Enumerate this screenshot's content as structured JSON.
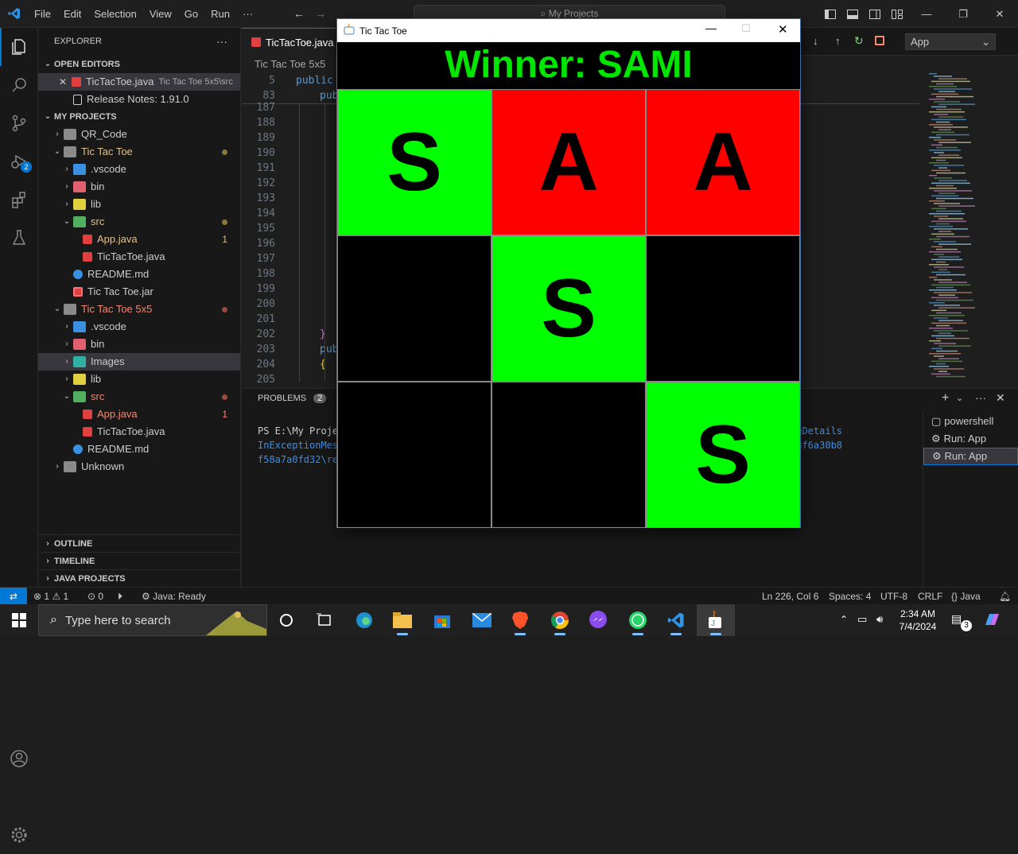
{
  "titlebar": {
    "menu": [
      "File",
      "Edit",
      "Selection",
      "View",
      "Go",
      "Run",
      "···"
    ],
    "search": "My Projects"
  },
  "activity": {
    "debug_badge": "2"
  },
  "sidebar": {
    "title": "EXPLORER",
    "more": "···",
    "open_editors_header": "OPEN EDITORS",
    "open_editors": [
      {
        "name": "TicTacToe.java",
        "desc": "Tic Tac Toe 5x5\\src"
      },
      {
        "name": "Release Notes: 1.91.0"
      }
    ],
    "projects_header": "MY PROJECTS",
    "tree": [
      {
        "label": "QR_Code",
        "indent": 0,
        "chev": "›",
        "icon": "folder"
      },
      {
        "label": "Tic Tac Toe",
        "indent": 0,
        "chev": "⌄",
        "icon": "folder-open",
        "color": "#e2c08d",
        "dot": "#8a7a3a"
      },
      {
        "label": ".vscode",
        "indent": 1,
        "chev": "›",
        "icon": "vscode"
      },
      {
        "label": "bin",
        "indent": 1,
        "chev": "›",
        "icon": "bin"
      },
      {
        "label": "lib",
        "indent": 1,
        "chev": "›",
        "icon": "lib"
      },
      {
        "label": "src",
        "indent": 1,
        "chev": "⌄",
        "icon": "src",
        "color": "#e2c08d",
        "dot": "#8a7a3a"
      },
      {
        "label": "App.java",
        "indent": 2,
        "chev": "",
        "icon": "java",
        "color": "#e2c08d",
        "count": "1",
        "countColor": "#e2c08d"
      },
      {
        "label": "TicTacToe.java",
        "indent": 2,
        "chev": "",
        "icon": "java"
      },
      {
        "label": "README.md",
        "indent": 1,
        "chev": "",
        "icon": "info"
      },
      {
        "label": "Tic Tac Toe.jar",
        "indent": 1,
        "chev": "",
        "icon": "jar"
      },
      {
        "label": "Tic Tac Toe 5x5",
        "indent": 0,
        "chev": "⌄",
        "icon": "folder-open",
        "color": "#f48771",
        "dot": "#9a4a3a"
      },
      {
        "label": ".vscode",
        "indent": 1,
        "chev": "›",
        "icon": "vscode"
      },
      {
        "label": "bin",
        "indent": 1,
        "chev": "›",
        "icon": "bin"
      },
      {
        "label": "Images",
        "indent": 1,
        "chev": "›",
        "icon": "images",
        "selected": true
      },
      {
        "label": "lib",
        "indent": 1,
        "chev": "›",
        "icon": "lib"
      },
      {
        "label": "src",
        "indent": 1,
        "chev": "⌄",
        "icon": "src",
        "color": "#f48771",
        "dot": "#9a4a3a"
      },
      {
        "label": "App.java",
        "indent": 2,
        "chev": "",
        "icon": "java",
        "color": "#f48771",
        "count": "1",
        "countColor": "#f48771"
      },
      {
        "label": "TicTacToe.java",
        "indent": 2,
        "chev": "",
        "icon": "java"
      },
      {
        "label": "README.md",
        "indent": 1,
        "chev": "",
        "icon": "info"
      },
      {
        "label": "Unknown",
        "indent": 0,
        "chev": "›",
        "icon": "folder"
      }
    ],
    "outline": "OUTLINE",
    "timeline": "TIMELINE",
    "java_projects": "JAVA PROJECTS"
  },
  "editor": {
    "tab": "TicTacToe.java",
    "breadcrumb": "Tic Tac Toe 5x5",
    "sticky": [
      {
        "num": "5",
        "text": "public"
      },
      {
        "num": "83",
        "text": "pub"
      }
    ],
    "lines": [
      {
        "num": "187",
        "text": ""
      },
      {
        "num": "188",
        "text": ""
      },
      {
        "num": "189",
        "text": ""
      },
      {
        "num": "190",
        "text": ""
      },
      {
        "num": "191",
        "text": ""
      },
      {
        "num": "192",
        "text": ""
      },
      {
        "num": "193",
        "text": ""
      },
      {
        "num": "194",
        "text": ""
      },
      {
        "num": "195",
        "text": ""
      },
      {
        "num": "196",
        "text": ""
      },
      {
        "num": "197",
        "text": ""
      },
      {
        "num": "198",
        "text": ""
      },
      {
        "num": "199",
        "text": ""
      },
      {
        "num": "200",
        "text": ""
      },
      {
        "num": "201",
        "text": ""
      },
      {
        "num": "202",
        "text": "}"
      },
      {
        "num": "203",
        "text": "pub"
      },
      {
        "num": "204",
        "text": "{"
      },
      {
        "num": "205",
        "text": ""
      }
    ],
    "run_select": "App"
  },
  "panel": {
    "problems_label": "PROBLEMS",
    "problems_count": "2",
    "terminal_left": [
      "PS E:\\My Proje",
      "InExceptionMes",
      "f58a7a0fd32\\re"
    ],
    "terminal_right": [
      "leDetails",
      "28f6a30b8"
    ],
    "terminals": [
      "powershell",
      "Run: App",
      "Run: App"
    ]
  },
  "statusbar": {
    "errors": "1",
    "warnings": "1",
    "info": "0",
    "java": "Java: Ready",
    "position": "Ln 226, Col 6",
    "spaces": "Spaces: 4",
    "encoding": "UTF-8",
    "eol": "CRLF",
    "lang": "Java"
  },
  "taskbar": {
    "search": "Type here to search",
    "time": "2:34 AM",
    "date": "7/4/2024",
    "notif": "3"
  },
  "game": {
    "window_title": "Tic Tac Toe",
    "winner": "Winner: SAMI",
    "cells": [
      {
        "letter": "S",
        "color": "#00ff00"
      },
      {
        "letter": "A",
        "color": "#ff0000"
      },
      {
        "letter": "A",
        "color": "#ff0000"
      },
      {
        "letter": "",
        "color": "#000000"
      },
      {
        "letter": "S",
        "color": "#00ff00"
      },
      {
        "letter": "",
        "color": "#000000"
      },
      {
        "letter": "",
        "color": "#000000"
      },
      {
        "letter": "",
        "color": "#000000"
      },
      {
        "letter": "S",
        "color": "#00ff00"
      }
    ]
  }
}
